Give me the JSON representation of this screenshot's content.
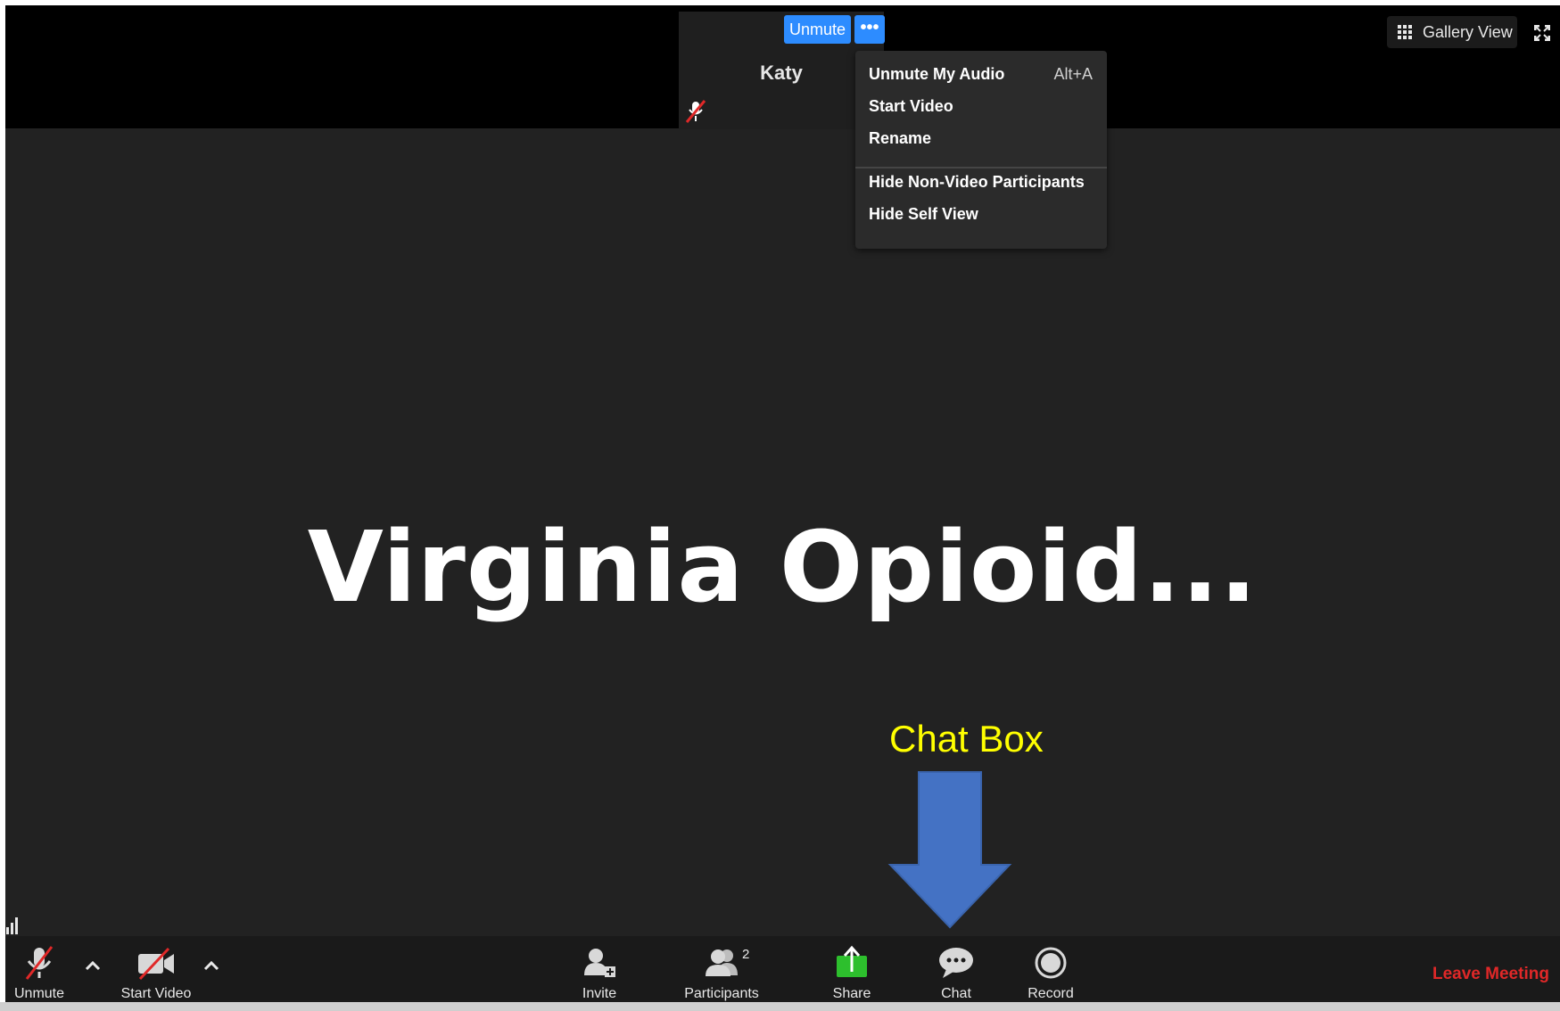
{
  "participant": {
    "name": "Katy",
    "unmute_label": "Unmute",
    "more_label": "•••"
  },
  "context_menu": {
    "items": [
      {
        "label": "Unmute My Audio",
        "shortcut": "Alt+A"
      },
      {
        "label": "Start Video"
      },
      {
        "label": "Rename"
      },
      {
        "label": "Hide Non-Video Participants"
      },
      {
        "label": "Hide Self View"
      }
    ]
  },
  "header": {
    "gallery_view_label": "Gallery View"
  },
  "shared_screen": {
    "title": "Virginia  Opioid..."
  },
  "annotation": {
    "label": "Chat Box",
    "label_color": "#ffff00",
    "arrow_color": "#4472c4"
  },
  "toolbar": {
    "unmute_label": "Unmute",
    "start_video_label": "Start Video",
    "invite_label": "Invite",
    "participants_label": "Participants",
    "participants_count": "2",
    "share_label": "Share",
    "chat_label": "Chat",
    "record_label": "Record",
    "leave_label": "Leave Meeting"
  },
  "colors": {
    "accent_blue": "#2d8cff",
    "share_green": "#2dbf2d",
    "leave_red": "#e02828",
    "muted_red": "#e02828"
  },
  "icons": [
    "microphone-muted-icon",
    "video-off-icon",
    "invite-icon",
    "participants-icon",
    "share-screen-icon",
    "chat-icon",
    "record-icon",
    "gallery-grid-icon",
    "fullscreen-icon",
    "signal-icon",
    "chevron-up-icon"
  ]
}
